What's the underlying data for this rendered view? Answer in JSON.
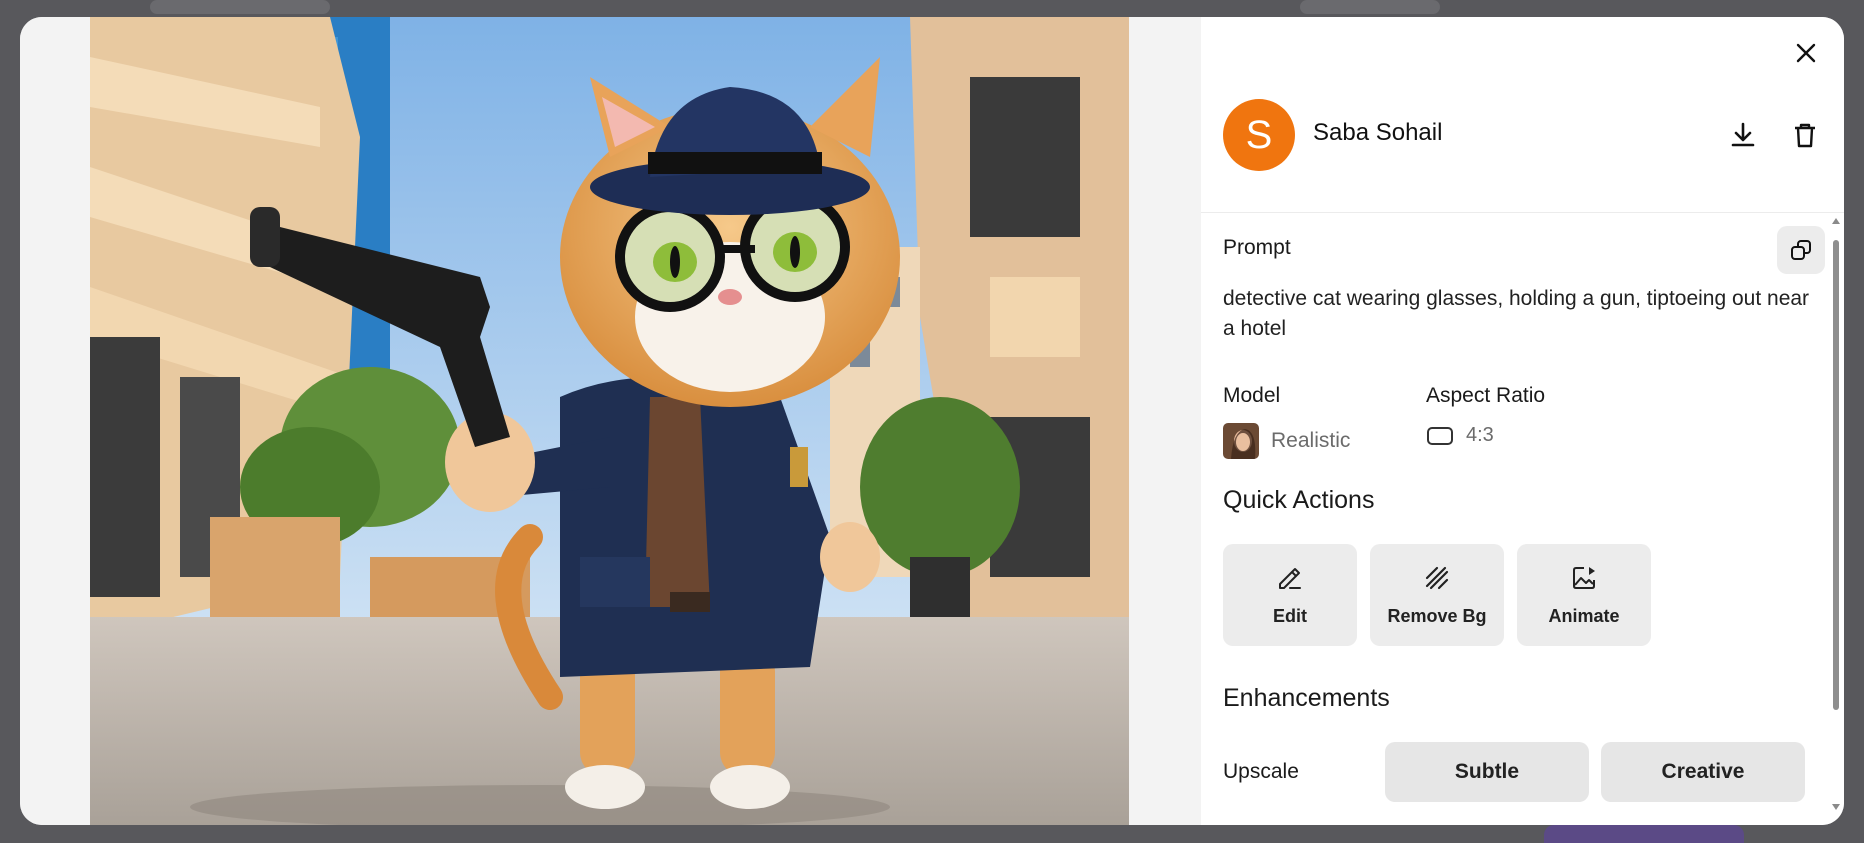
{
  "user": {
    "avatar_letter": "S",
    "name": "Saba Sohail",
    "avatar_color": "#f0750f"
  },
  "icons": {
    "close": "close-icon",
    "download": "download-icon",
    "delete": "trash-icon",
    "copy": "copy-icon"
  },
  "prompt": {
    "label": "Prompt",
    "text": "detective cat wearing glasses, holding a gun, tiptoeing out near a hotel"
  },
  "model": {
    "label": "Model",
    "value": "Realistic"
  },
  "aspect_ratio": {
    "label": "Aspect Ratio",
    "value": "4:3"
  },
  "quick_actions": {
    "title": "Quick Actions",
    "items": [
      {
        "label": "Edit",
        "icon": "pencil-icon"
      },
      {
        "label": "Remove Bg",
        "icon": "hatch-icon"
      },
      {
        "label": "Animate",
        "icon": "animate-image-icon"
      }
    ]
  },
  "enhancements": {
    "title": "Enhancements",
    "upscale_label": "Upscale",
    "options": [
      "Subtle",
      "Creative"
    ]
  }
}
